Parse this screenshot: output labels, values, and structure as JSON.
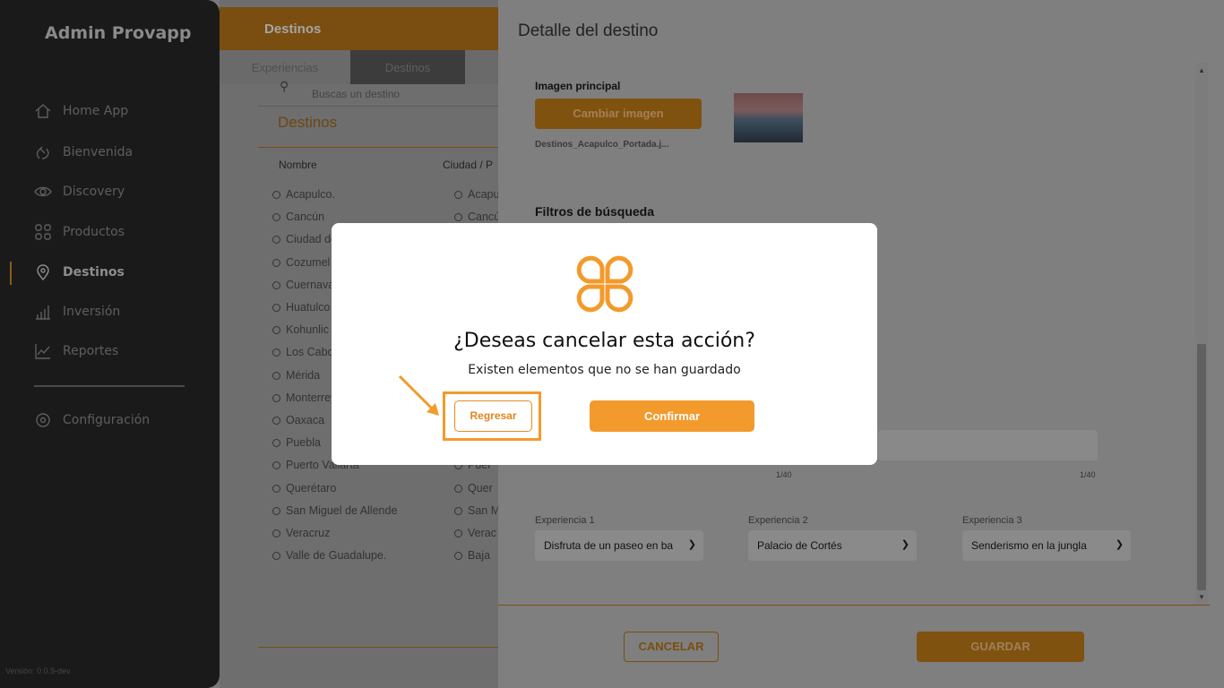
{
  "sidebar": {
    "brand": "Admin Provapp",
    "items": [
      {
        "label": "Home App",
        "icon": "home-icon"
      },
      {
        "label": "Bienvenida",
        "icon": "wave-hand-icon"
      },
      {
        "label": "Discovery",
        "icon": "eye-icon"
      },
      {
        "label": "Productos",
        "icon": "grid-icon"
      },
      {
        "label": "Destinos",
        "icon": "location-pin-icon",
        "active": true
      },
      {
        "label": "Inversión",
        "icon": "bar-chart-icon"
      },
      {
        "label": "Reportes",
        "icon": "line-chart-icon"
      }
    ],
    "settings": {
      "label": "Configuración",
      "icon": "gear-icon"
    },
    "version": "Versión: 0.0.9-dev"
  },
  "main": {
    "title": "Destinos",
    "tabs": [
      "Experiencias",
      "Destinos"
    ],
    "search_placeholder": "Buscas un destino",
    "list_title": "Destinos",
    "columns": [
      "Nombre",
      "Ciudad / P"
    ],
    "rows": [
      {
        "name": "Acapulco.",
        "city": "Acapulco"
      },
      {
        "name": "Cancún",
        "city": "Cancún"
      },
      {
        "name": "Ciudad de",
        "city": ""
      },
      {
        "name": "Cozumel",
        "city": ""
      },
      {
        "name": "Cuernava",
        "city": ""
      },
      {
        "name": "Huatulco",
        "city": ""
      },
      {
        "name": "Kohunlic",
        "city": ""
      },
      {
        "name": "Los Cabo",
        "city": ""
      },
      {
        "name": "Mérida",
        "city": ""
      },
      {
        "name": "Monterrey",
        "city": ""
      },
      {
        "name": "Oaxaca",
        "city": ""
      },
      {
        "name": "Puebla",
        "city": ""
      },
      {
        "name": "Puerto Vallarta",
        "city": "Puer"
      },
      {
        "name": "Querétaro",
        "city": "Quer"
      },
      {
        "name": "San Miguel de Allende",
        "city": "San M"
      },
      {
        "name": "Veracruz",
        "city": "Verac"
      },
      {
        "name": "Valle de Guadalupe.",
        "city": "Baja"
      }
    ]
  },
  "drawer": {
    "title": "Detalle del destino",
    "image_label": "Imagen principal",
    "change_image": "Cambiar imagen",
    "filename": "Destinos_Acapulco_Portada.j...",
    "filters_title": "Filtros de búsqueda",
    "counter_a": "1/40",
    "counter_b": "1/40",
    "experiences": [
      {
        "label": "Experiencia 1",
        "value": "Disfruta de un paseo en ba"
      },
      {
        "label": "Experiencia 2",
        "value": "Palacio de Cortés"
      },
      {
        "label": "Experiencia 3",
        "value": "Senderismo en la jungla"
      }
    ],
    "cancel": "CANCELAR",
    "save": "GUARDAR"
  },
  "modal": {
    "title": "¿Deseas cancelar esta acción?",
    "subtitle": "Existen elementos que no se han guardado",
    "back": "Regresar",
    "confirm": "Confirmar"
  },
  "colors": {
    "accent": "#f39a2c",
    "sidebar_bg": "#1a1a1a"
  }
}
